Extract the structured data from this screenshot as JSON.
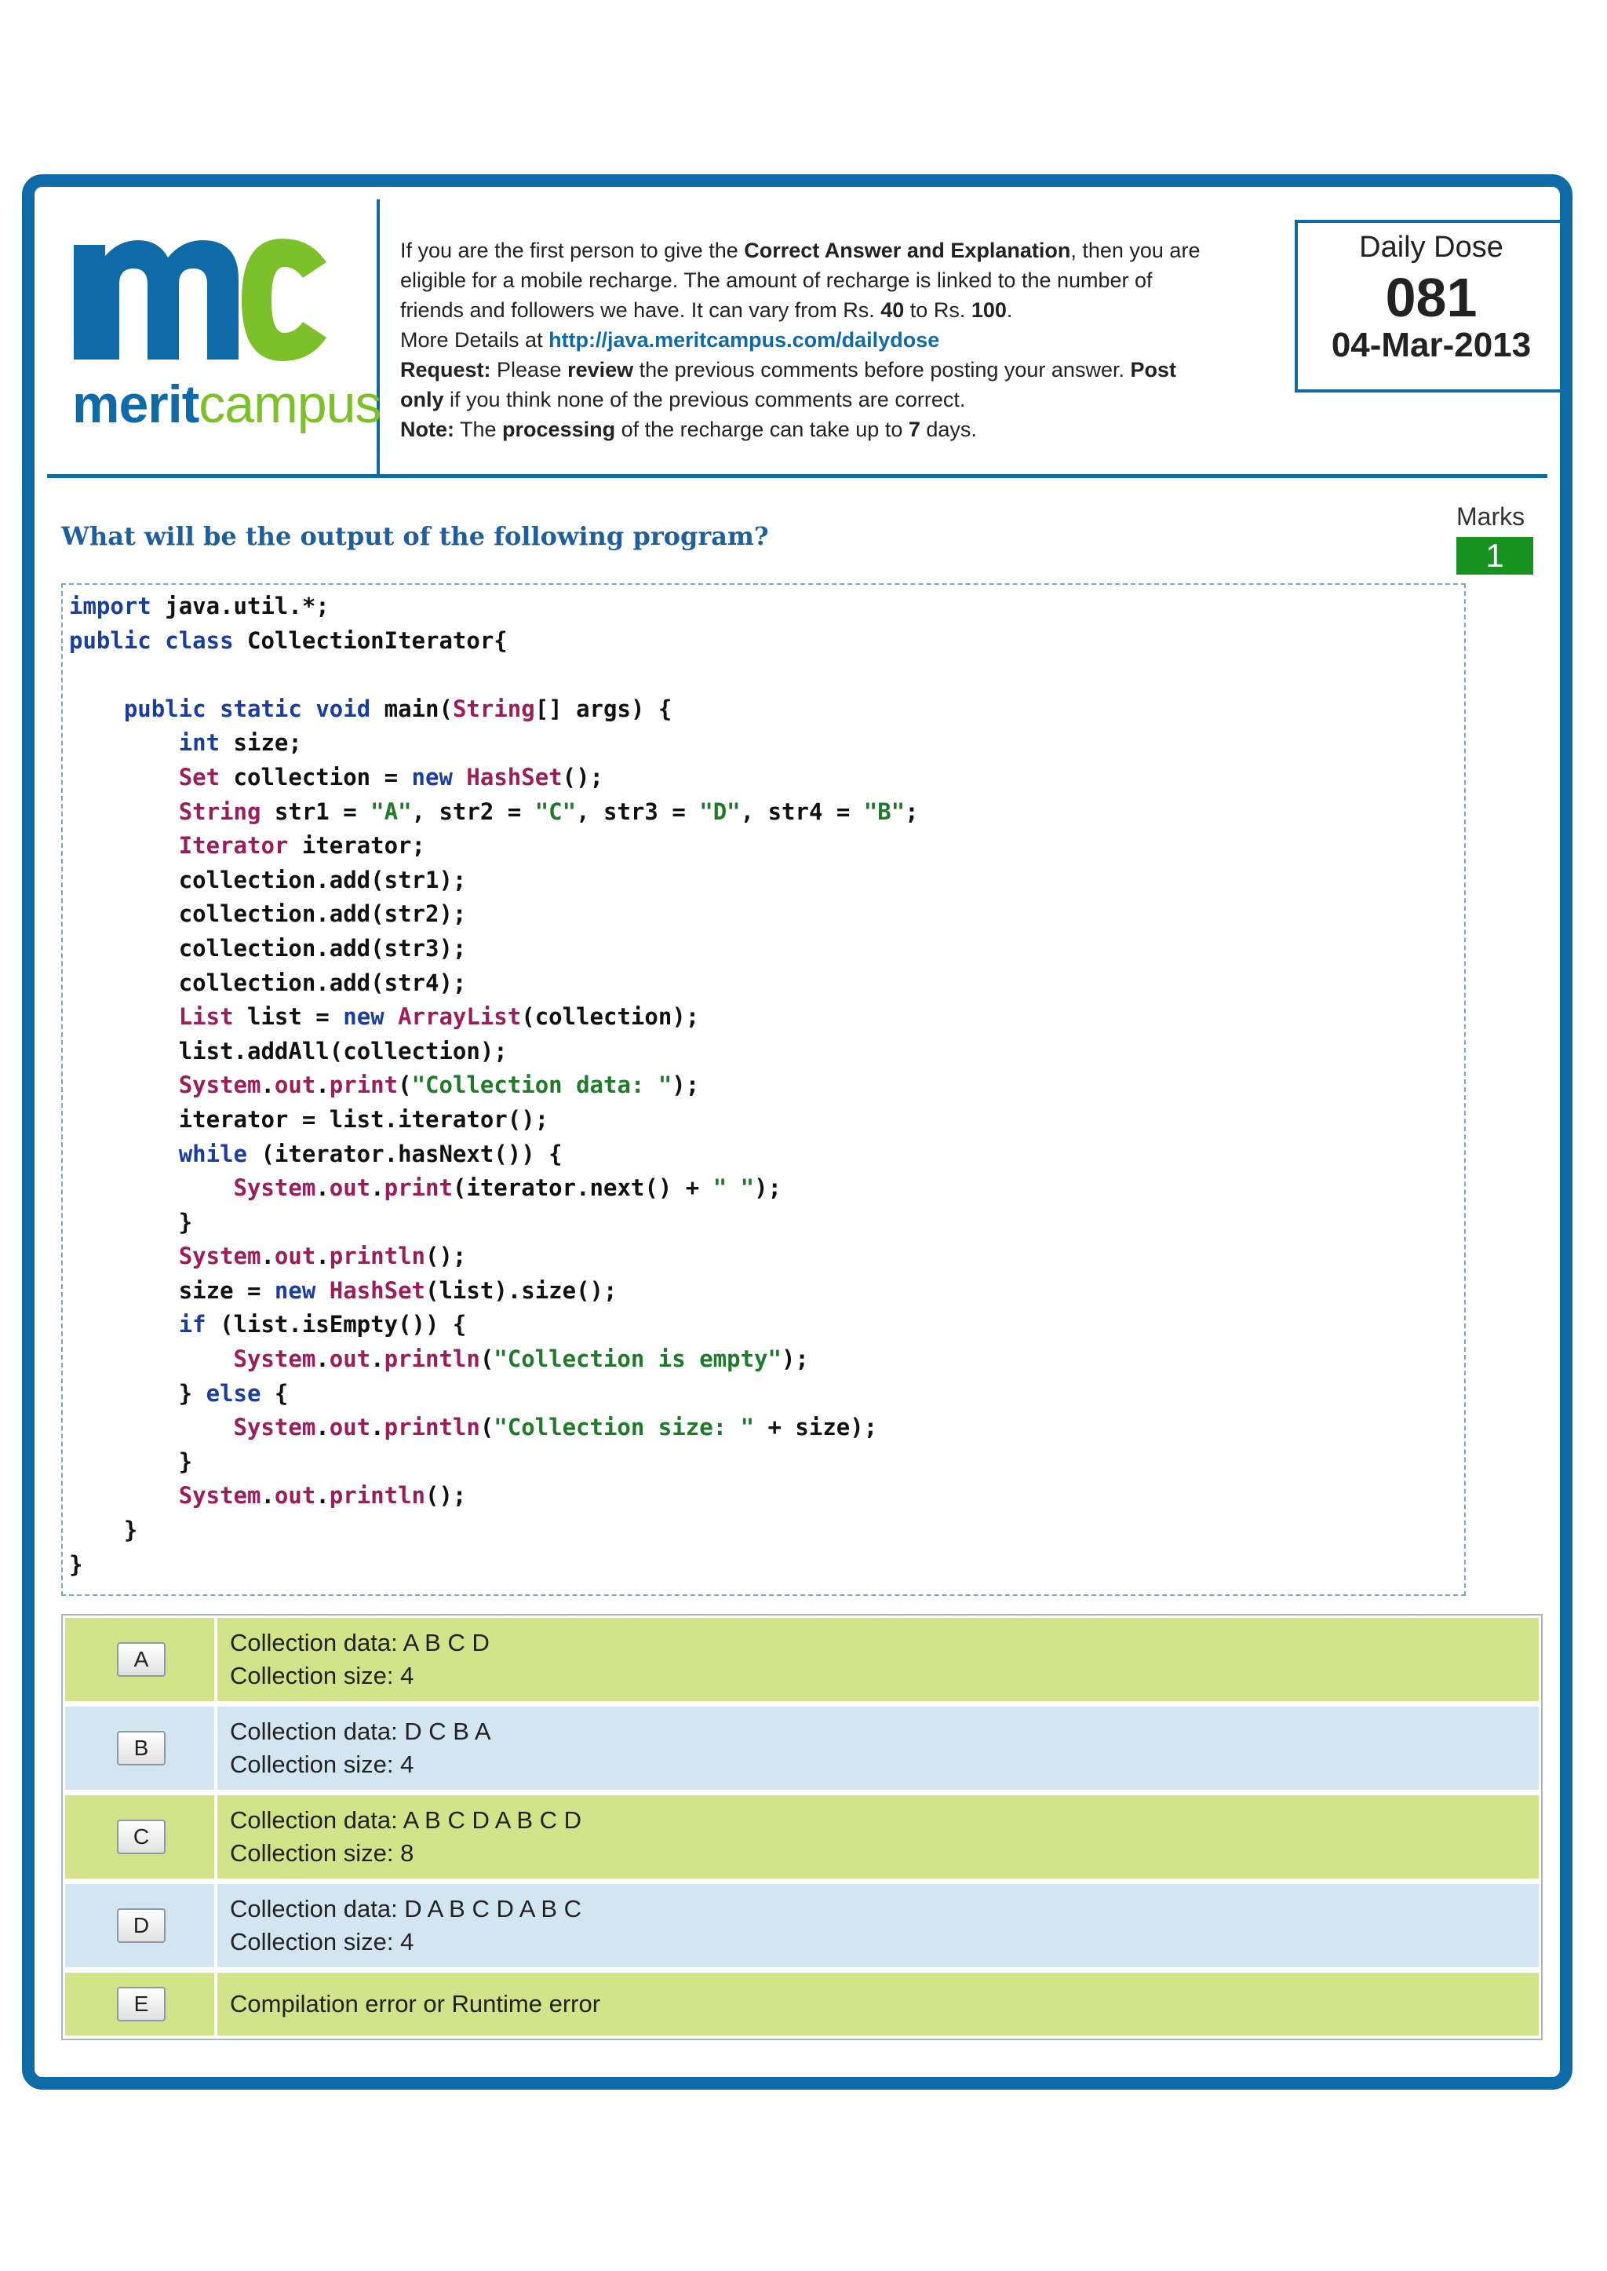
{
  "header": {
    "logo": {
      "mark": "mc",
      "brand_part1": "merit",
      "brand_part2": "campus"
    },
    "info_lines": [
      [
        "If you are the first person to give the ",
        "Correct Answer and Explanation",
        ", then you are"
      ],
      [
        "eligible for a mobile recharge. The amount of recharge is linked to the number of"
      ],
      [
        "friends and followers we have. It can vary from Rs. ",
        "40",
        " to Rs. ",
        "100",
        "."
      ],
      [
        "More Details at ",
        "http://java.meritcampus.com/dailydose"
      ],
      [
        "Request:",
        " Please ",
        "review",
        " the previous comments before posting your answer. ",
        "Post"
      ],
      [
        "only",
        " if you think none of the previous comments are correct."
      ],
      [
        "Note:",
        " The ",
        "processing",
        " of the recharge can take up to ",
        "7",
        " days."
      ]
    ],
    "daily_dose": {
      "title": "Daily Dose",
      "number": "081",
      "date": "04-Mar-2013"
    }
  },
  "question": "What will be the output of the following program?",
  "marks": {
    "label": "Marks",
    "value": "1"
  },
  "code_lines": [
    "import java.util.*;",
    "public class CollectionIterator{",
    "",
    "    public static void main(String[] args) {",
    "        int size;",
    "        Set collection = new HashSet();",
    "        String str1 = \"A\", str2 = \"C\", str3 = \"D\", str4 = \"B\";",
    "        Iterator iterator;",
    "        collection.add(str1);",
    "        collection.add(str2);",
    "        collection.add(str3);",
    "        collection.add(str4);",
    "        List list = new ArrayList(collection);",
    "        list.addAll(collection);",
    "        System.out.print(\"Collection data: \");",
    "        iterator = list.iterator();",
    "        while (iterator.hasNext()) {",
    "            System.out.print(iterator.next() + \" \");",
    "        }",
    "        System.out.println();",
    "        size = new HashSet(list).size();",
    "        if (list.isEmpty()) {",
    "            System.out.println(\"Collection is empty\");",
    "        } else {",
    "            System.out.println(\"Collection size: \" + size);",
    "        }",
    "        System.out.println();",
    "    }",
    "}"
  ],
  "options": [
    {
      "label": "A",
      "lines": [
        "Collection data: A B C D",
        "Collection size: 4"
      ],
      "color": "#d2e38a"
    },
    {
      "label": "B",
      "lines": [
        "Collection data: D C B A",
        "Collection size: 4"
      ],
      "color": "#d2e5f1"
    },
    {
      "label": "C",
      "lines": [
        "Collection data: A B C D A B C D",
        "Collection size: 8"
      ],
      "color": "#d2e38a"
    },
    {
      "label": "D",
      "lines": [
        "Collection data: D A B C D A B C",
        "Collection size: 4"
      ],
      "color": "#d2e5f1"
    },
    {
      "label": "E",
      "lines": [
        "Compilation error or Runtime error"
      ],
      "color": "#d2e38a"
    }
  ],
  "colors": {
    "frame": "#0f6aa8",
    "logo_green": "#7cc02a",
    "marks_bg": "#17911f",
    "question": "#1f5fa0"
  }
}
